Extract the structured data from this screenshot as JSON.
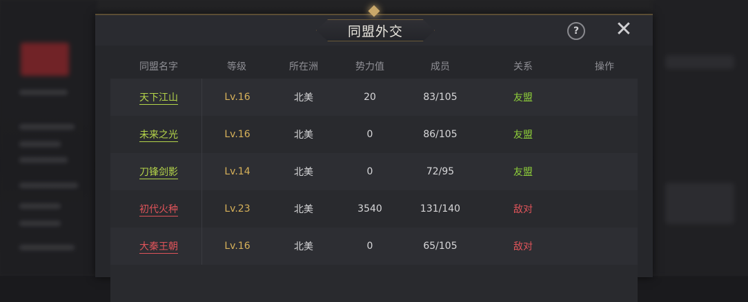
{
  "dialog": {
    "title": "同盟外交",
    "help_label": "?",
    "close_label": "✕"
  },
  "table": {
    "headers": [
      "同盟名字",
      "等级",
      "所在洲",
      "势力值",
      "成员",
      "关系",
      "操作"
    ],
    "rows": [
      {
        "name": "天下江山",
        "level": "Lv.16",
        "continent": "北美",
        "power": "20",
        "members": "83/105",
        "relation": "友盟",
        "relation_type": "ally"
      },
      {
        "name": "未来之光",
        "level": "Lv.16",
        "continent": "北美",
        "power": "0",
        "members": "86/105",
        "relation": "友盟",
        "relation_type": "ally"
      },
      {
        "name": "刀锋剑影",
        "level": "Lv.14",
        "continent": "北美",
        "power": "0",
        "members": "72/95",
        "relation": "友盟",
        "relation_type": "ally"
      },
      {
        "name": "初代火种",
        "level": "Lv.23",
        "continent": "北美",
        "power": "3540",
        "members": "131/140",
        "relation": "敌对",
        "relation_type": "enemy"
      },
      {
        "name": "大秦王朝",
        "level": "Lv.16",
        "continent": "北美",
        "power": "0",
        "members": "65/105",
        "relation": "敌对",
        "relation_type": "enemy"
      }
    ]
  },
  "colors": {
    "ally": "#8ecf3a",
    "enemy": "#e0545a",
    "level": "#d8b25a",
    "accent_gold": "#c9a86a"
  }
}
